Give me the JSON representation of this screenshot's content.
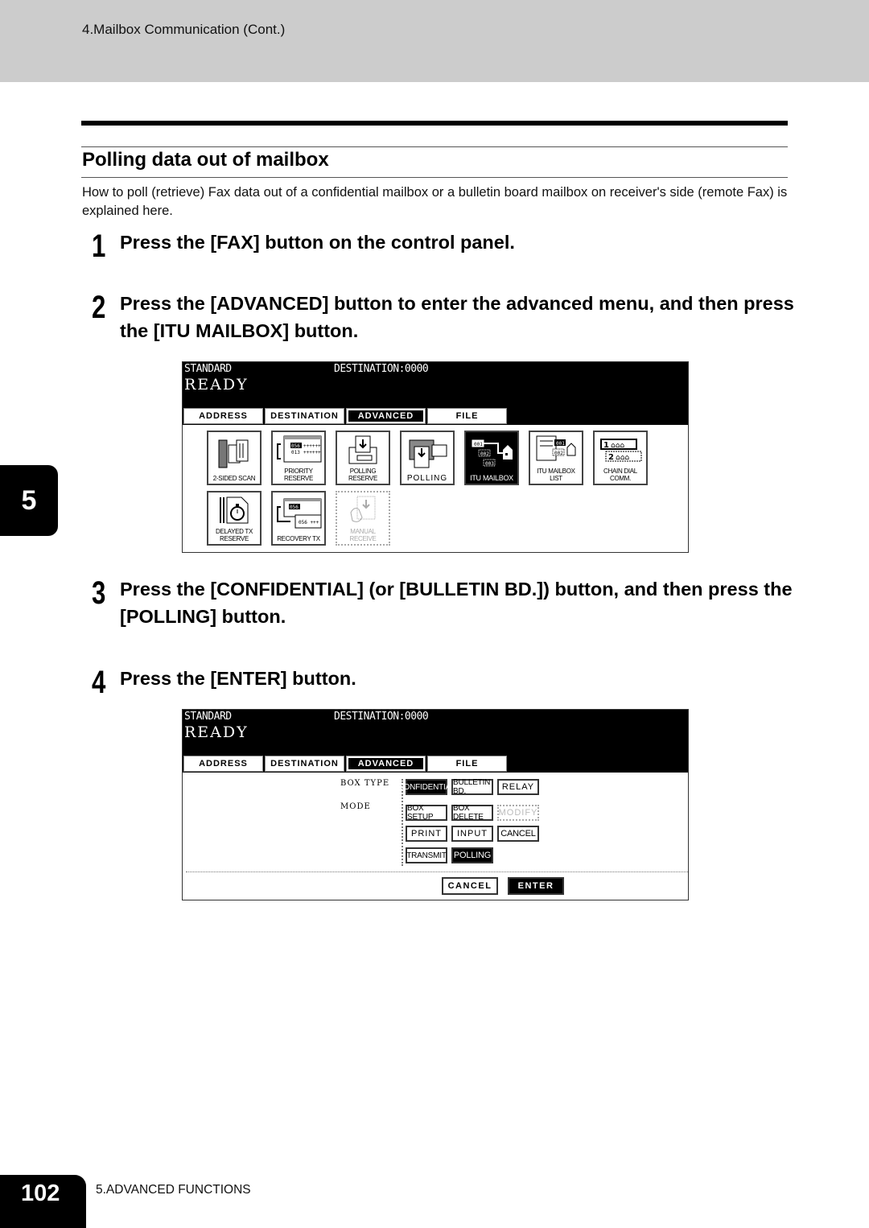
{
  "header": {
    "breadcrumb": "4.Mailbox Communication (Cont.)"
  },
  "section": {
    "title": "Polling data out of mailbox",
    "intro": "How to poll (retrieve) Fax data out of a confidential mailbox or a bulletin board mailbox on receiver's side (remote Fax) is explained here."
  },
  "steps": [
    {
      "number": "1",
      "text": "Press the [FAX] button on the control panel."
    },
    {
      "number": "2",
      "text": "Press the [ADVANCED] button to enter the advanced menu, and then press the [ITU MAILBOX] button."
    },
    {
      "number": "3",
      "text": "Press the [CONFIDENTIAL] (or [BULLETIN BD.]) button, and then press the [POLLING] button."
    },
    {
      "number": "4",
      "text": "Press the [ENTER] button."
    }
  ],
  "screen1": {
    "mode": "STANDARD",
    "destination": "DESTINATION:0000",
    "status": "READY",
    "tabs": [
      "ADDRESS",
      "DESTINATION",
      "ADVANCED",
      "FILE"
    ],
    "active_tab": "ADVANCED",
    "icons": [
      {
        "label": "2-SIDED SCAN",
        "icon": "duplex-scan-icon",
        "state": "normal"
      },
      {
        "label": "PRIORITY RESERVE",
        "icon": "priority-reserve-icon",
        "state": "normal"
      },
      {
        "label": "POLLING RESERVE",
        "icon": "polling-reserve-icon",
        "state": "normal"
      },
      {
        "label": "POLLING",
        "icon": "polling-icon",
        "state": "normal"
      },
      {
        "label": "ITU MAILBOX",
        "icon": "itu-mailbox-icon",
        "state": "selected"
      },
      {
        "label": "ITU MAILBOX LIST",
        "icon": "itu-mailbox-list-icon",
        "state": "normal"
      },
      {
        "label": "CHAIN DIAL COMM.",
        "icon": "chain-dial-icon",
        "state": "normal"
      },
      {
        "label": "DELAYED TX\nRESERVE",
        "icon": "stopwatch-icon",
        "state": "normal"
      },
      {
        "label": "RECOVERY TX",
        "icon": "recovery-tx-icon",
        "state": "normal"
      },
      {
        "label": "MANUAL RECEIVE",
        "icon": "manual-receive-icon",
        "state": "disabled"
      }
    ]
  },
  "screen2": {
    "mode": "STANDARD",
    "destination": "DESTINATION:0000",
    "status": "READY",
    "tabs": [
      "ADDRESS",
      "DESTINATION",
      "ADVANCED",
      "FILE"
    ],
    "active_tab": "ADVANCED",
    "box_type_label": "BOX TYPE",
    "mode_label": "MODE",
    "box_types": [
      {
        "label": "CONFIDENTIAL",
        "state": "selected"
      },
      {
        "label": "BULLETIN BD.",
        "state": "normal"
      },
      {
        "label": "RELAY",
        "state": "normal"
      }
    ],
    "modes": [
      {
        "label": "BOX SETUP",
        "state": "normal"
      },
      {
        "label": "BOX DELETE",
        "state": "normal"
      },
      {
        "label": "MODIFY",
        "state": "disabled"
      },
      {
        "label": "PRINT",
        "state": "normal"
      },
      {
        "label": "INPUT",
        "state": "normal"
      },
      {
        "label": "CANCEL",
        "state": "normal"
      },
      {
        "label": "TRANSMIT",
        "state": "normal"
      },
      {
        "label": "POLLING",
        "state": "selected"
      }
    ],
    "cancel_label": "CANCEL",
    "enter_label": "ENTER"
  },
  "chapter_tab": "5",
  "footer": {
    "page_number": "102",
    "chapter_label": "5.ADVANCED FUNCTIONS"
  }
}
